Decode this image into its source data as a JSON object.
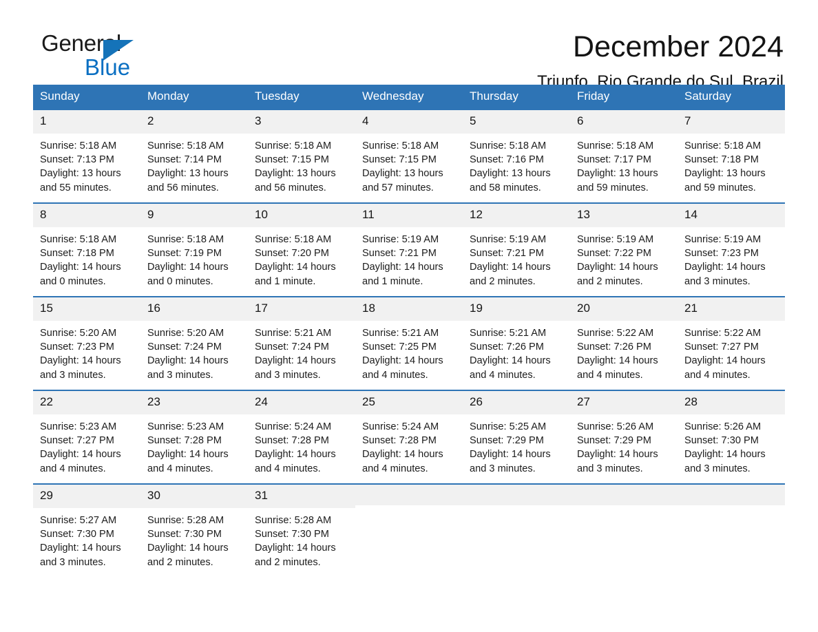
{
  "brand": {
    "word1": "General",
    "word2": "Blue",
    "flag_icon": "triangle-flag-icon",
    "accent_color": "#1573b9"
  },
  "header": {
    "month_title": "December 2024",
    "location": "Triunfo, Rio Grande do Sul, Brazil"
  },
  "theme": {
    "header_blue": "#2e74b5",
    "daynum_gray": "#f1f1f1",
    "text": "#1c1c1c"
  },
  "weekdays": [
    "Sunday",
    "Monday",
    "Tuesday",
    "Wednesday",
    "Thursday",
    "Friday",
    "Saturday"
  ],
  "weeks": [
    [
      {
        "day": "1",
        "sunrise": "Sunrise: 5:18 AM",
        "sunset": "Sunset: 7:13 PM",
        "daylight": "Daylight: 13 hours and 55 minutes."
      },
      {
        "day": "2",
        "sunrise": "Sunrise: 5:18 AM",
        "sunset": "Sunset: 7:14 PM",
        "daylight": "Daylight: 13 hours and 56 minutes."
      },
      {
        "day": "3",
        "sunrise": "Sunrise: 5:18 AM",
        "sunset": "Sunset: 7:15 PM",
        "daylight": "Daylight: 13 hours and 56 minutes."
      },
      {
        "day": "4",
        "sunrise": "Sunrise: 5:18 AM",
        "sunset": "Sunset: 7:15 PM",
        "daylight": "Daylight: 13 hours and 57 minutes."
      },
      {
        "day": "5",
        "sunrise": "Sunrise: 5:18 AM",
        "sunset": "Sunset: 7:16 PM",
        "daylight": "Daylight: 13 hours and 58 minutes."
      },
      {
        "day": "6",
        "sunrise": "Sunrise: 5:18 AM",
        "sunset": "Sunset: 7:17 PM",
        "daylight": "Daylight: 13 hours and 59 minutes."
      },
      {
        "day": "7",
        "sunrise": "Sunrise: 5:18 AM",
        "sunset": "Sunset: 7:18 PM",
        "daylight": "Daylight: 13 hours and 59 minutes."
      }
    ],
    [
      {
        "day": "8",
        "sunrise": "Sunrise: 5:18 AM",
        "sunset": "Sunset: 7:18 PM",
        "daylight": "Daylight: 14 hours and 0 minutes."
      },
      {
        "day": "9",
        "sunrise": "Sunrise: 5:18 AM",
        "sunset": "Sunset: 7:19 PM",
        "daylight": "Daylight: 14 hours and 0 minutes."
      },
      {
        "day": "10",
        "sunrise": "Sunrise: 5:18 AM",
        "sunset": "Sunset: 7:20 PM",
        "daylight": "Daylight: 14 hours and 1 minute."
      },
      {
        "day": "11",
        "sunrise": "Sunrise: 5:19 AM",
        "sunset": "Sunset: 7:21 PM",
        "daylight": "Daylight: 14 hours and 1 minute."
      },
      {
        "day": "12",
        "sunrise": "Sunrise: 5:19 AM",
        "sunset": "Sunset: 7:21 PM",
        "daylight": "Daylight: 14 hours and 2 minutes."
      },
      {
        "day": "13",
        "sunrise": "Sunrise: 5:19 AM",
        "sunset": "Sunset: 7:22 PM",
        "daylight": "Daylight: 14 hours and 2 minutes."
      },
      {
        "day": "14",
        "sunrise": "Sunrise: 5:19 AM",
        "sunset": "Sunset: 7:23 PM",
        "daylight": "Daylight: 14 hours and 3 minutes."
      }
    ],
    [
      {
        "day": "15",
        "sunrise": "Sunrise: 5:20 AM",
        "sunset": "Sunset: 7:23 PM",
        "daylight": "Daylight: 14 hours and 3 minutes."
      },
      {
        "day": "16",
        "sunrise": "Sunrise: 5:20 AM",
        "sunset": "Sunset: 7:24 PM",
        "daylight": "Daylight: 14 hours and 3 minutes."
      },
      {
        "day": "17",
        "sunrise": "Sunrise: 5:21 AM",
        "sunset": "Sunset: 7:24 PM",
        "daylight": "Daylight: 14 hours and 3 minutes."
      },
      {
        "day": "18",
        "sunrise": "Sunrise: 5:21 AM",
        "sunset": "Sunset: 7:25 PM",
        "daylight": "Daylight: 14 hours and 4 minutes."
      },
      {
        "day": "19",
        "sunrise": "Sunrise: 5:21 AM",
        "sunset": "Sunset: 7:26 PM",
        "daylight": "Daylight: 14 hours and 4 minutes."
      },
      {
        "day": "20",
        "sunrise": "Sunrise: 5:22 AM",
        "sunset": "Sunset: 7:26 PM",
        "daylight": "Daylight: 14 hours and 4 minutes."
      },
      {
        "day": "21",
        "sunrise": "Sunrise: 5:22 AM",
        "sunset": "Sunset: 7:27 PM",
        "daylight": "Daylight: 14 hours and 4 minutes."
      }
    ],
    [
      {
        "day": "22",
        "sunrise": "Sunrise: 5:23 AM",
        "sunset": "Sunset: 7:27 PM",
        "daylight": "Daylight: 14 hours and 4 minutes."
      },
      {
        "day": "23",
        "sunrise": "Sunrise: 5:23 AM",
        "sunset": "Sunset: 7:28 PM",
        "daylight": "Daylight: 14 hours and 4 minutes."
      },
      {
        "day": "24",
        "sunrise": "Sunrise: 5:24 AM",
        "sunset": "Sunset: 7:28 PM",
        "daylight": "Daylight: 14 hours and 4 minutes."
      },
      {
        "day": "25",
        "sunrise": "Sunrise: 5:24 AM",
        "sunset": "Sunset: 7:28 PM",
        "daylight": "Daylight: 14 hours and 4 minutes."
      },
      {
        "day": "26",
        "sunrise": "Sunrise: 5:25 AM",
        "sunset": "Sunset: 7:29 PM",
        "daylight": "Daylight: 14 hours and 3 minutes."
      },
      {
        "day": "27",
        "sunrise": "Sunrise: 5:26 AM",
        "sunset": "Sunset: 7:29 PM",
        "daylight": "Daylight: 14 hours and 3 minutes."
      },
      {
        "day": "28",
        "sunrise": "Sunrise: 5:26 AM",
        "sunset": "Sunset: 7:30 PM",
        "daylight": "Daylight: 14 hours and 3 minutes."
      }
    ],
    [
      {
        "day": "29",
        "sunrise": "Sunrise: 5:27 AM",
        "sunset": "Sunset: 7:30 PM",
        "daylight": "Daylight: 14 hours and 3 minutes."
      },
      {
        "day": "30",
        "sunrise": "Sunrise: 5:28 AM",
        "sunset": "Sunset: 7:30 PM",
        "daylight": "Daylight: 14 hours and 2 minutes."
      },
      {
        "day": "31",
        "sunrise": "Sunrise: 5:28 AM",
        "sunset": "Sunset: 7:30 PM",
        "daylight": "Daylight: 14 hours and 2 minutes."
      },
      {
        "day": "",
        "sunrise": "",
        "sunset": "",
        "daylight": ""
      },
      {
        "day": "",
        "sunrise": "",
        "sunset": "",
        "daylight": ""
      },
      {
        "day": "",
        "sunrise": "",
        "sunset": "",
        "daylight": ""
      },
      {
        "day": "",
        "sunrise": "",
        "sunset": "",
        "daylight": ""
      }
    ]
  ]
}
